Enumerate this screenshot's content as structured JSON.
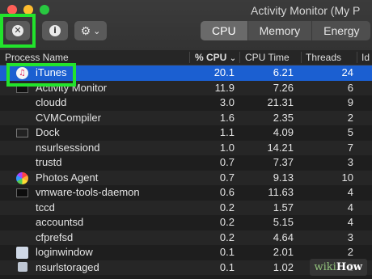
{
  "window": {
    "title": "Activity Monitor (My P"
  },
  "toolbar": {
    "stop_icon": "x-circle-icon",
    "stop_glyph": "✕",
    "info_icon": "info-icon",
    "info_glyph": "i",
    "gear_icon": "gear-icon",
    "gear_glyph": "⚙",
    "chevron_glyph": "⌄"
  },
  "tabs": [
    {
      "label": "CPU",
      "active": true
    },
    {
      "label": "Memory",
      "active": false
    },
    {
      "label": "Energy",
      "active": false
    }
  ],
  "columns": {
    "process_name": "Process Name",
    "cpu": "% CPU",
    "cpu_sort_indicator": "⌄",
    "cpu_time": "CPU Time",
    "threads": "Threads",
    "idle": "Id"
  },
  "processes": [
    {
      "name": "iTunes",
      "cpu": "20.1",
      "cpu_time": "6.21",
      "threads": "24",
      "icon": "itunes-icon",
      "selected": true,
      "icon_glyph": "♫"
    },
    {
      "name": "Activity Monitor",
      "cpu": "11.9",
      "cpu_time": "7.26",
      "threads": "6",
      "icon": "activity-monitor-icon"
    },
    {
      "name": "cloudd",
      "cpu": "3.0",
      "cpu_time": "21.31",
      "threads": "9",
      "icon": ""
    },
    {
      "name": "CVMCompiler",
      "cpu": "1.6",
      "cpu_time": "2.35",
      "threads": "2",
      "icon": ""
    },
    {
      "name": "Dock",
      "cpu": "1.1",
      "cpu_time": "4.09",
      "threads": "5",
      "icon": "dock-icon"
    },
    {
      "name": "nsurlsessiond",
      "cpu": "1.0",
      "cpu_time": "14.21",
      "threads": "7",
      "icon": ""
    },
    {
      "name": "trustd",
      "cpu": "0.7",
      "cpu_time": "7.37",
      "threads": "3",
      "icon": ""
    },
    {
      "name": "Photos Agent",
      "cpu": "0.7",
      "cpu_time": "9.13",
      "threads": "10",
      "icon": "photos-agent-icon"
    },
    {
      "name": "vmware-tools-daemon",
      "cpu": "0.6",
      "cpu_time": "11.63",
      "threads": "4",
      "icon": "vmware-icon"
    },
    {
      "name": "tccd",
      "cpu": "0.2",
      "cpu_time": "1.57",
      "threads": "4",
      "icon": ""
    },
    {
      "name": "accountsd",
      "cpu": "0.2",
      "cpu_time": "5.15",
      "threads": "4",
      "icon": ""
    },
    {
      "name": "cfprefsd",
      "cpu": "0.2",
      "cpu_time": "4.64",
      "threads": "3",
      "icon": ""
    },
    {
      "name": "loginwindow",
      "cpu": "0.1",
      "cpu_time": "2.01",
      "threads": "2",
      "icon": "loginwindow-icon"
    },
    {
      "name": "nsurlstoraged",
      "cpu": "0.1",
      "cpu_time": "1.02",
      "threads": "2",
      "icon": "small-app-icon"
    }
  ],
  "highlight_color": "#22e32c",
  "selection_color": "#1b5fd1",
  "watermark": {
    "brand": "wiki",
    "suffix": "How"
  }
}
